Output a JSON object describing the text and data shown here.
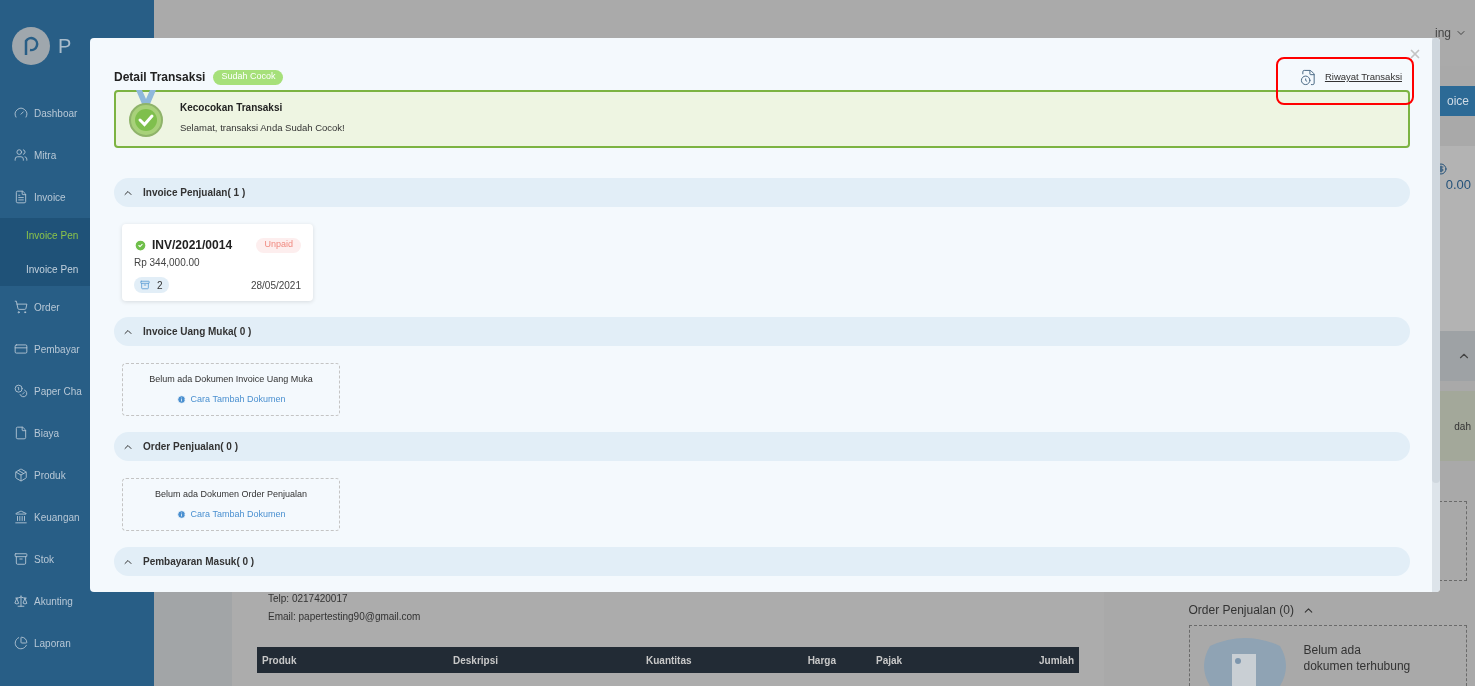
{
  "sidebar": {
    "logo_text": "P",
    "items": [
      {
        "label": "Dashboar",
        "selected": false
      },
      {
        "label": "Mitra",
        "selected": false
      },
      {
        "label": "Invoice",
        "selected": false,
        "expanded": true,
        "children": [
          {
            "label": "Invoice Pen",
            "selected": true
          },
          {
            "label": "Invoice Pen",
            "selected": false
          }
        ]
      },
      {
        "label": "Order",
        "selected": false
      },
      {
        "label": "Pembayar",
        "selected": false
      },
      {
        "label": "Paper Cha",
        "selected": false
      },
      {
        "label": "Biaya",
        "selected": false
      },
      {
        "label": "Produk",
        "selected": false
      },
      {
        "label": "Keuangan",
        "selected": false
      },
      {
        "label": "Stok",
        "selected": false
      },
      {
        "label": "Akunting",
        "selected": false
      },
      {
        "label": "Laporan",
        "selected": false
      }
    ]
  },
  "header": {
    "user_name": "ing"
  },
  "background": {
    "action_button": "oice",
    "total": "0.00",
    "notice": "dah",
    "contact": [
      "Telp: 0217420017",
      "Email: papertesting90@gmail.com"
    ],
    "table": {
      "columns": [
        "Produk",
        "Deskripsi",
        "Kuantitas",
        "Harga",
        "Pajak",
        "Jumlah"
      ]
    },
    "order_section": {
      "title": "Order Penjualan (0)",
      "empty_text": "Belum ada dokumen terhubung"
    }
  },
  "modal": {
    "title": "Detail Transaksi",
    "status": "Sudah Cocok",
    "history_link": "Riwayat Transaksi",
    "highlighted": true,
    "alert": {
      "title": "Kecocokan Transaksi",
      "message": "Selamat, transaksi Anda Sudah Cocok!"
    },
    "sections": [
      {
        "title": "Invoice Penjualan( 1 )",
        "expanded": true,
        "kind": "invoices",
        "invoices": [
          {
            "number": "INV/2021/0014",
            "status": "Unpaid",
            "amount": "Rp 344,000.00",
            "count": "2",
            "date": "28/05/2021",
            "matched": true
          }
        ]
      },
      {
        "title": "Invoice Uang Muka( 0 )",
        "expanded": true,
        "kind": "empty",
        "message": "Belum ada Dokumen Invoice Uang Muka",
        "link": "Cara Tambah Dokumen"
      },
      {
        "title": "Order Penjualan( 0 )",
        "expanded": true,
        "kind": "empty",
        "message": "Belum ada Dokumen Order Penjualan",
        "link": "Cara Tambah Dokumen"
      },
      {
        "title": "Pembayaran Masuk( 0 )",
        "expanded": true,
        "kind": "header"
      }
    ]
  }
}
